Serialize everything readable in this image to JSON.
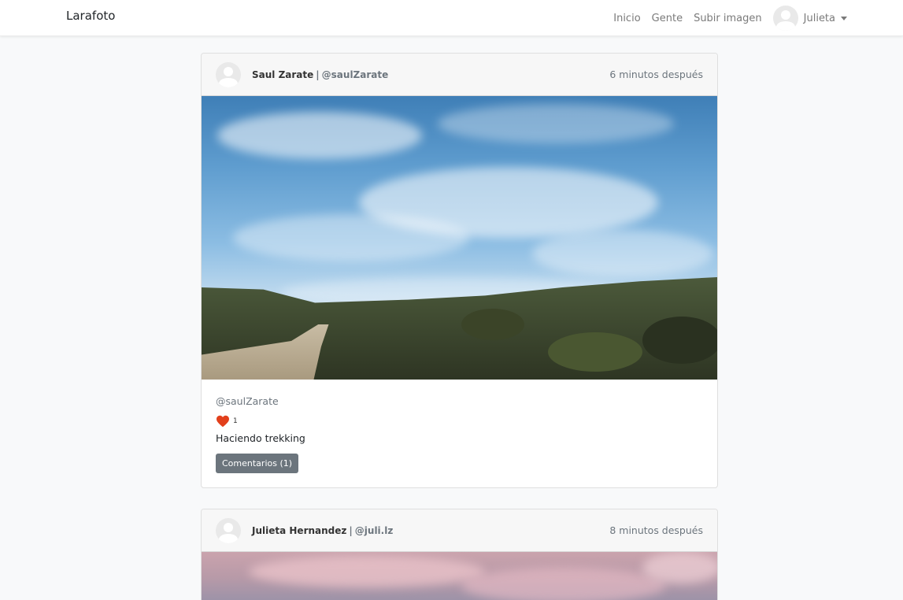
{
  "navbar": {
    "brand": "Larafoto",
    "links": [
      "Inicio",
      "Gente",
      "Subir imagen"
    ],
    "user_name": "Julieta"
  },
  "posts": [
    {
      "name": "Saul Zarate",
      "nick": "@saulZarate",
      "time": "6 minutos después",
      "body_nick": "@saulZarate",
      "likes": "1",
      "description": "Haciendo trekking",
      "comments_button": "Comentarios (1)"
    },
    {
      "name": "Julieta Hernandez",
      "nick": "@juli.lz",
      "time": "8 minutos después"
    }
  ],
  "colors": {
    "like_heart": "#e2401c",
    "button": "#6c757d"
  }
}
